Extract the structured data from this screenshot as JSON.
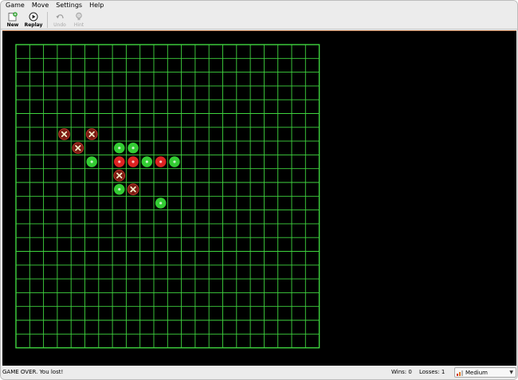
{
  "menu": [
    {
      "id": "game",
      "label": "Game"
    },
    {
      "id": "move",
      "label": "Move"
    },
    {
      "id": "settings",
      "label": "Settings"
    },
    {
      "id": "help",
      "label": "Help"
    }
  ],
  "toolbar": {
    "new_label": "New",
    "replay_label": "Replay",
    "undo_label": "Undo",
    "hint_label": "Hint"
  },
  "board": {
    "rows": 22,
    "cols": 22,
    "grid_color": "#3fd43f",
    "background": "#000000",
    "player_color": "#33cc33",
    "computer_color": "#dd2222",
    "pieces": {
      "green": [
        [
          5,
          8
        ],
        [
          7,
          7
        ],
        [
          7,
          10
        ],
        [
          8,
          7
        ],
        [
          9,
          8
        ],
        [
          10,
          11
        ],
        [
          11,
          8
        ]
      ],
      "red": [
        [
          7,
          8
        ],
        [
          8,
          8
        ],
        [
          10,
          8
        ]
      ],
      "x_marks": [
        [
          3,
          6
        ],
        [
          4,
          7
        ],
        [
          5,
          6
        ],
        [
          7,
          9
        ],
        [
          8,
          10
        ]
      ]
    }
  },
  "status": {
    "message": "GAME OVER. You lost!",
    "wins": "Wins: 0",
    "losses": "Losses: 1",
    "difficulty": "Medium"
  }
}
